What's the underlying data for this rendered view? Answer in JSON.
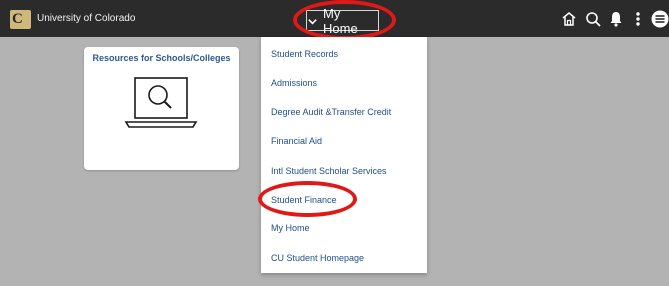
{
  "header": {
    "logo_letter": "C",
    "brand": "University of Colorado",
    "home_button_label": "My Home",
    "icons": [
      "home-icon",
      "search-icon",
      "bell-icon",
      "more-vertical-icon",
      "menu-icon"
    ]
  },
  "tile": {
    "title": "Resources for Schools/Colleges",
    "icon": "laptop-search-icon"
  },
  "dropdown": {
    "items": [
      {
        "label": "Student Records"
      },
      {
        "label": "Admissions"
      },
      {
        "label": "Degree Audit &Transfer Credit"
      },
      {
        "label": "Financial Aid"
      },
      {
        "label": "Intl Student Scholar Services"
      },
      {
        "label": "Student Finance"
      },
      {
        "label": "My Home"
      },
      {
        "label": "CU Student Homepage"
      }
    ]
  },
  "colors": {
    "topbar": "#2b2b2b",
    "background": "#b3b3b3",
    "gold": "#cfb87c",
    "link": "#1f4f8a",
    "highlight": "#e01818"
  }
}
